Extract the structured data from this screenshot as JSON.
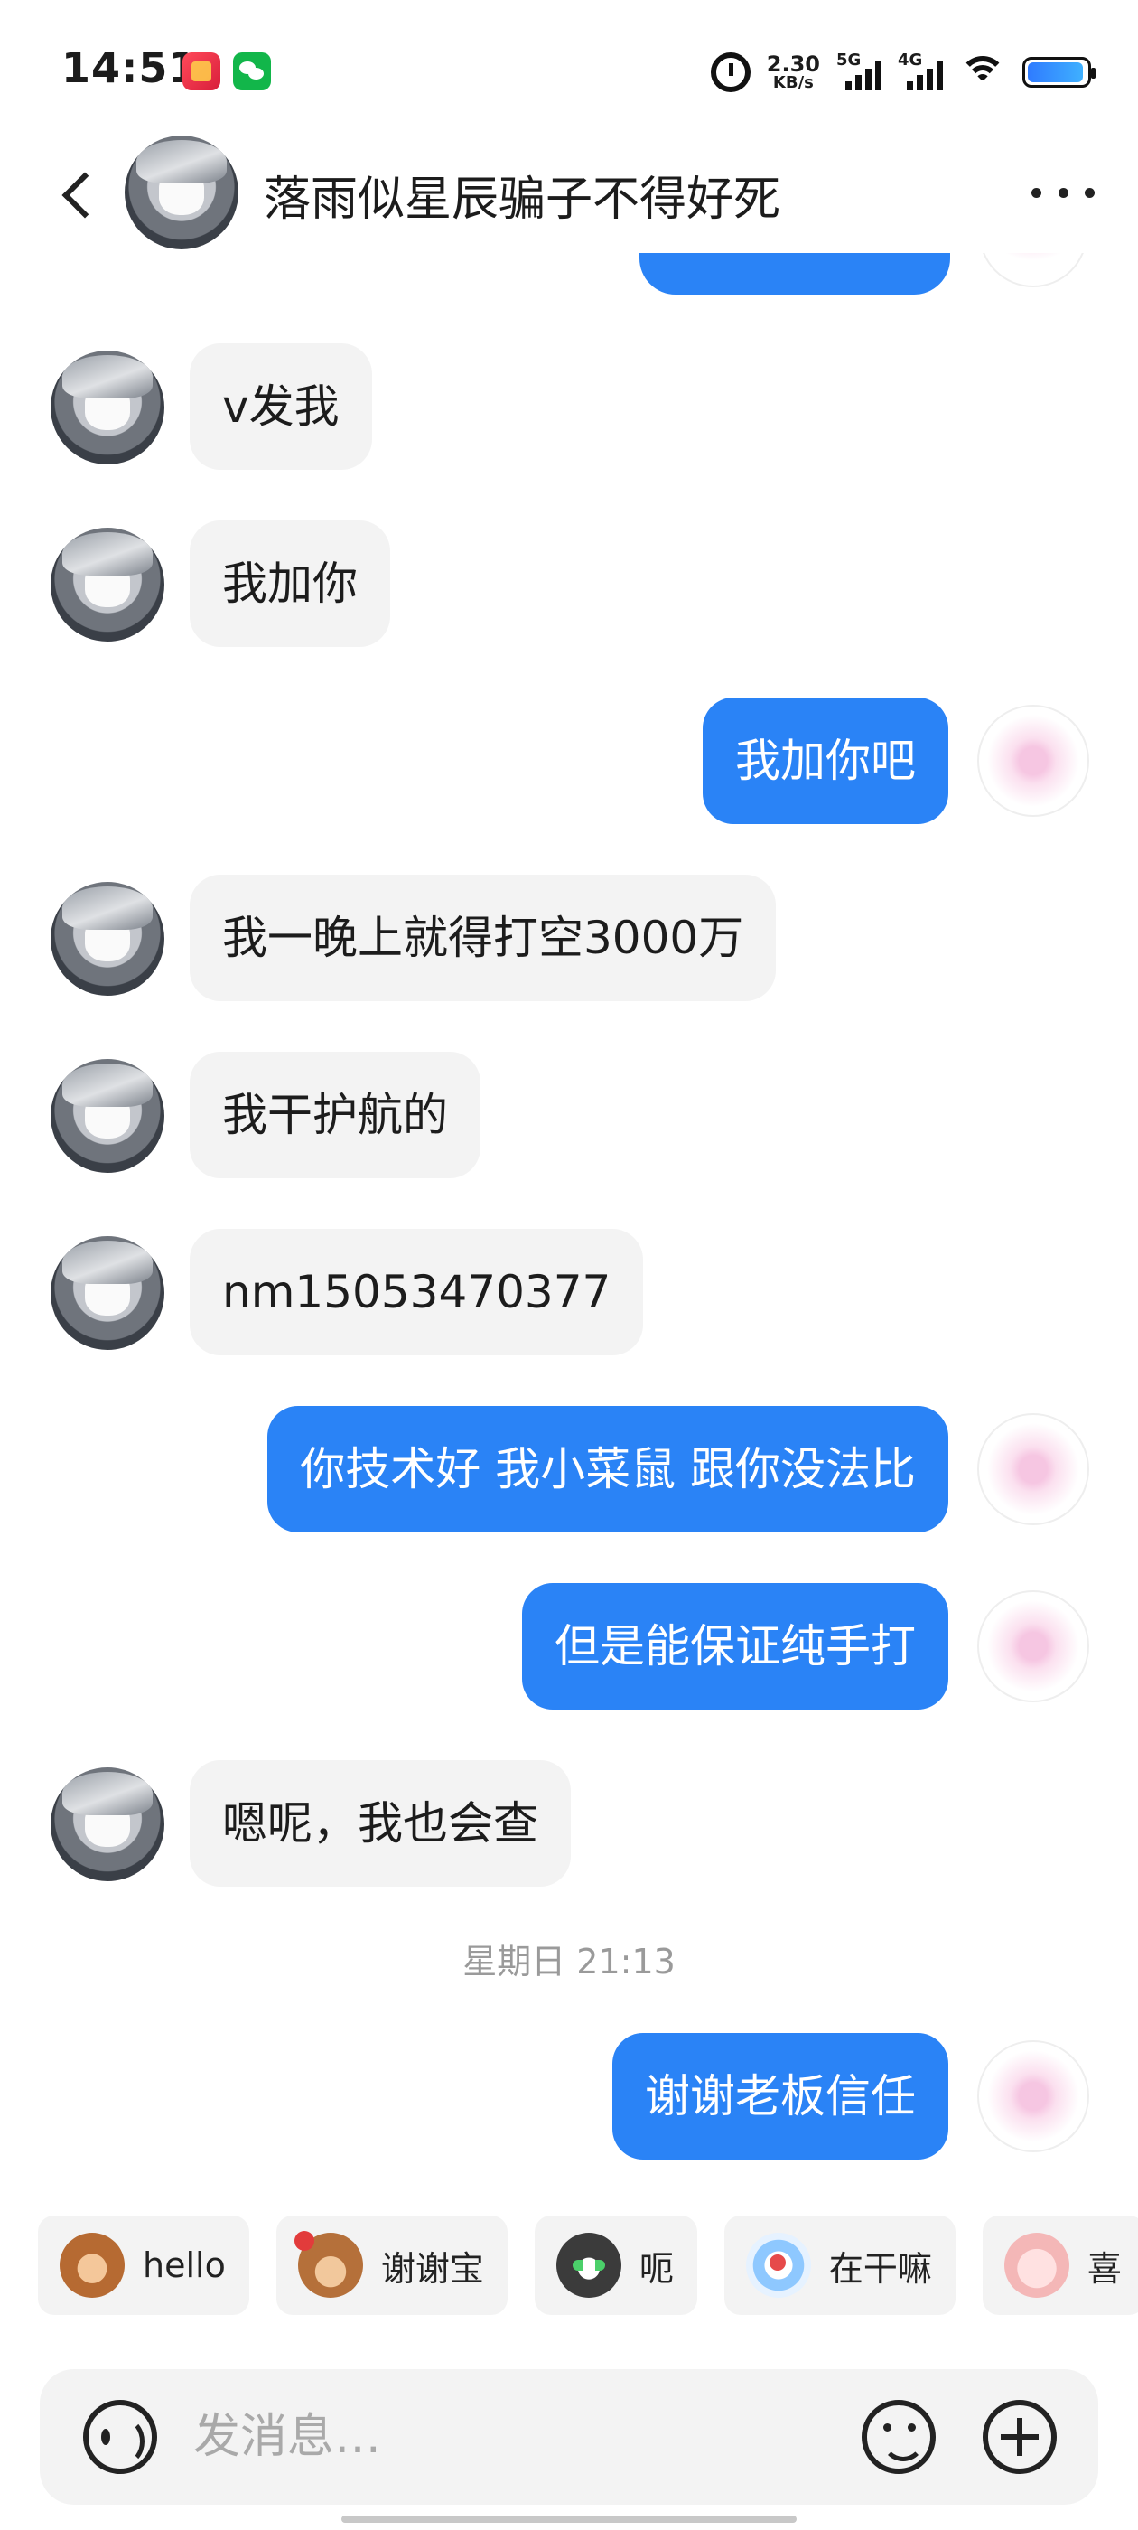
{
  "status_bar": {
    "time": "14:51",
    "network_speed_value": "2.30",
    "network_speed_unit": "KB/s",
    "signal_5g_label": "5G",
    "signal_4g_label": "4G",
    "battery_level": 0.95,
    "icons": [
      "calendar-app-icon",
      "wechat-icon",
      "alarm-icon",
      "signal-5g-icon",
      "signal-4g-icon",
      "wifi-icon",
      "battery-icon"
    ]
  },
  "header": {
    "title": "落雨似星辰骗子不得好死",
    "back_icon": "chevron-left-icon",
    "more_icon": "more-horizontal-icon"
  },
  "messages": [
    {
      "side": "in",
      "text": "v发我"
    },
    {
      "side": "in",
      "text": "我加你"
    },
    {
      "side": "out",
      "text": "我加你吧"
    },
    {
      "side": "in",
      "text": "我一晚上就得打空3000万"
    },
    {
      "side": "in",
      "text": "我干护航的"
    },
    {
      "side": "in",
      "text": "nm15053470377"
    },
    {
      "side": "out",
      "text": "你技术好 我小菜鼠 跟你没法比"
    },
    {
      "side": "out",
      "text": "但是能保证纯手打"
    },
    {
      "side": "in",
      "text": "嗯呢，我也会查"
    },
    {
      "side": "out",
      "text": "谢谢老板信任"
    }
  ],
  "timestamp": "星期日 21:13",
  "quick_replies": [
    {
      "label": "hello",
      "sticker": "monkey-sticker"
    },
    {
      "label": "谢谢宝",
      "sticker": "monkey-rose-sticker"
    },
    {
      "label": "呃",
      "sticker": "cat-sticker"
    },
    {
      "label": "在干嘛",
      "sticker": "ghost-sticker"
    },
    {
      "label": "喜",
      "sticker": "pig-sticker"
    }
  ],
  "input": {
    "placeholder": "发消息…",
    "voice_icon": "voice-icon",
    "emoji_icon": "emoji-icon",
    "plus_icon": "plus-icon"
  }
}
